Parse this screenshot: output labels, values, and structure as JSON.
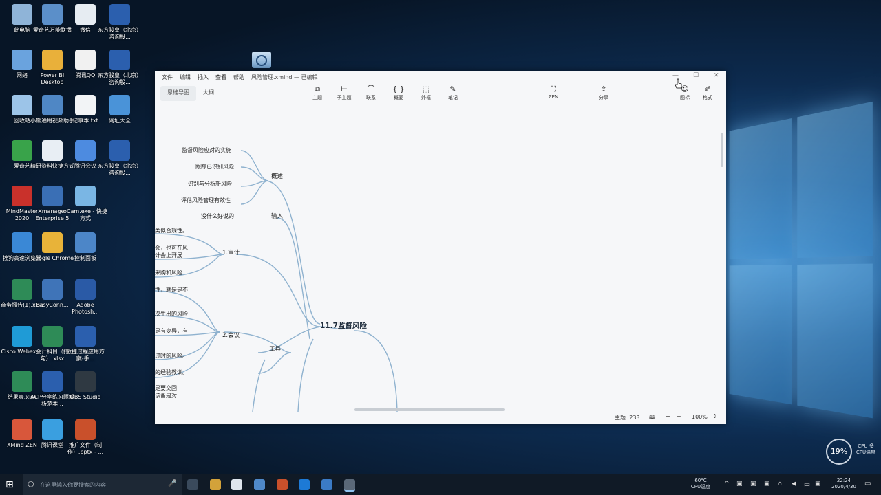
{
  "desktop": {
    "icons": [
      {
        "label": "此电脑",
        "color": "#8fb4d8"
      },
      {
        "label": "爱奇艺万能联播",
        "color": "#5b8fc9"
      },
      {
        "label": "微信",
        "color": "#e6ecf2"
      },
      {
        "label": "东方骏皇（北京）咨询股...",
        "color": "#2b5fae"
      },
      {
        "label": "网络",
        "color": "#6aa3de"
      },
      {
        "label": "Power BI Desktop",
        "color": "#e9b03a"
      },
      {
        "label": "腾讯QQ",
        "color": "#f1f1f1"
      },
      {
        "label": "东方骏皇（北京）咨询股...",
        "color": "#2b5fae"
      },
      {
        "label": "回收站",
        "color": "#9cc4e8"
      },
      {
        "label": "小熊通用视频助手",
        "color": "#4f87c5"
      },
      {
        "label": "记事本.txt",
        "color": "#f2f4f6"
      },
      {
        "label": "网址大全",
        "color": "#4a93d8"
      },
      {
        "label": "爱奇艺",
        "color": "#39a34a"
      },
      {
        "label": "精研资料快捷方式",
        "color": "#e8eef4"
      },
      {
        "label": "腾讯会议",
        "color": "#4d8be0"
      },
      {
        "label": "东方骏皇（北京）咨询股...",
        "color": "#2b5fae"
      },
      {
        "label": "MindMaster 2020",
        "color": "#c9312b"
      },
      {
        "label": "Xmanager Enterprise 5",
        "color": "#3a6fb5"
      },
      {
        "label": "oCam.exe - 快捷方式",
        "color": "#7ab6e4"
      },
      {
        "label": "搜狗高速浏览器",
        "color": "#3a88d6"
      },
      {
        "label": "Google Chrome",
        "color": "#e8b339"
      },
      {
        "label": "控制面板",
        "color": "#4c86c8"
      },
      {
        "label": "商务报告(1).xlsx",
        "color": "#2e8b57"
      },
      {
        "label": "EasyConn...",
        "color": "#3f74b8"
      },
      {
        "label": "Adobe Photosh...",
        "color": "#2a5aa6"
      },
      {
        "label": "Cisco Webex ...",
        "color": "#1f9bd6"
      },
      {
        "label": "会计科目（打勾）.xlsx",
        "color": "#2e8b57"
      },
      {
        "label": "敏捷过程应用方案-手...",
        "color": "#2b5fae"
      },
      {
        "label": "结果表.xlsx",
        "color": "#2e8b57"
      },
      {
        "label": "ACP分享练习题解析范本...",
        "color": "#2b5fae"
      },
      {
        "label": "OBS Studio",
        "color": "#2f3942"
      },
      {
        "label": "XMind ZEN",
        "color": "#d8573b"
      },
      {
        "label": "腾讯课堂",
        "color": "#3a9fe0"
      },
      {
        "label": "推广文件（制作）.pptx - ...",
        "color": "#c9502b"
      }
    ]
  },
  "app": {
    "menu": [
      "文件",
      "编辑",
      "插入",
      "查看",
      "帮助"
    ],
    "doc_title": "风险管理.xmind — 已编辑",
    "view_tabs": [
      "思维导图",
      "大纲"
    ],
    "toolbar": [
      {
        "label": "主题",
        "icon": "topic-icon"
      },
      {
        "label": "子主题",
        "icon": "subtopic-icon"
      },
      {
        "label": "联系",
        "icon": "relationship-icon"
      },
      {
        "label": "概要",
        "icon": "summary-icon"
      },
      {
        "label": "外框",
        "icon": "boundary-icon"
      },
      {
        "label": "笔记",
        "icon": "note-icon"
      },
      {
        "label": "ZEN",
        "icon": "zen-icon"
      },
      {
        "label": "分享",
        "icon": "share-icon"
      },
      {
        "label": "图标",
        "icon": "sticker-icon"
      },
      {
        "label": "格式",
        "icon": "format-icon"
      }
    ],
    "status": {
      "topic_count": "主题: 233",
      "zoom": "100%"
    },
    "mindmap": {
      "center": "11.7监督风险",
      "branches": {
        "overview": "概述",
        "input": "输入",
        "tools": "工具",
        "audit": "1.审计",
        "meeting": "2.会议"
      },
      "overview_items": [
        "监督风险应对的实施",
        "跟踪已识别风险",
        "识别与分析新风险",
        "评估风险管理有效性"
      ],
      "input_item": "没什么好说的",
      "audit_items": [
        "类似合规性。",
        "会，也可在风",
        "计会上开展",
        "采购和风险"
      ],
      "meeting_items": [
        "性，就是是不",
        "次生出的风险",
        "是有变异，有",
        "过时的风险。",
        "的经验教训。",
        "是要交回",
        "该备是对"
      ]
    }
  },
  "tray": {
    "cpu_usage": "19%",
    "temp": "60°C",
    "temp_label": "CPU温度",
    "cpu_small": "CPU 多",
    "cpu_small2": "CPU温度",
    "time": "22:24",
    "date": "2020/4/30",
    "search_placeholder": "在这里输入你要搜索的内容"
  }
}
